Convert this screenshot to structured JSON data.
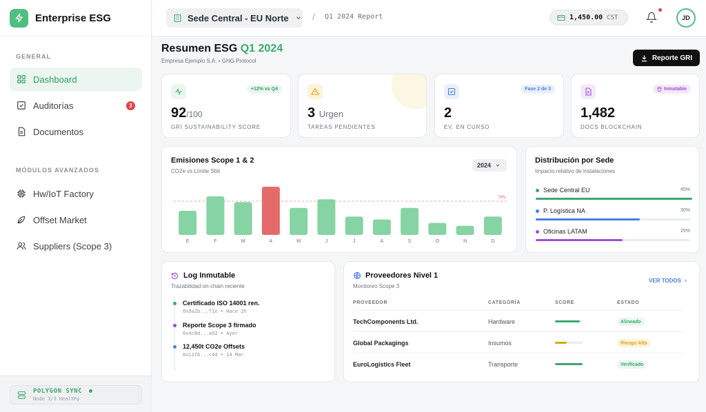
{
  "brand": {
    "name": "Enterprise ESG"
  },
  "sidebar": {
    "section_general": "GENERAL",
    "section_advanced": "MÓDULOS AVANZADOS",
    "items": [
      {
        "label": "Dashboard",
        "icon": "grid-icon"
      },
      {
        "label": "Auditorías",
        "icon": "checkbox-icon",
        "badge": "3"
      },
      {
        "label": "Documentos",
        "icon": "document-icon"
      },
      {
        "label": "Hw/IoT Factory",
        "icon": "chip-icon"
      },
      {
        "label": "Offset Market",
        "icon": "leaf-icon"
      },
      {
        "label": "Suppliers (Scope 3)",
        "icon": "users-icon"
      }
    ],
    "sync": {
      "title": "POLYGON SYNC",
      "subtitle": "Node 3/3 Healthy",
      "color": "#3aa96b"
    }
  },
  "header": {
    "site": "Sede Central - EU Norte",
    "breadcrumb_sep": "/",
    "breadcrumb": "Q1 2024 Report",
    "credits_value": "1,450.00",
    "credits_unit": "CST",
    "avatar": "JD"
  },
  "page": {
    "title": "Resumen ESG",
    "title_accent": "Q1 2024",
    "subtitle": "Empresa Ejemplo S.A. • GHG Protocol",
    "report_button": "Reporte GRI"
  },
  "kpis": [
    {
      "value": "92",
      "suffix": "/100",
      "label": "GRI SUSTAINABILITY SCORE",
      "badge": "+12% vs Q4",
      "color": "#3aa96b"
    },
    {
      "value": "3",
      "suffix": "Urgen",
      "label": "TAREAS PENDIENTES",
      "badge": "",
      "color": "#d9a514"
    },
    {
      "value": "2",
      "suffix": "",
      "label": "EV. EN CURSO",
      "badge": "Fase 2 de 3",
      "color": "#4a7de0"
    },
    {
      "value": "1,482",
      "suffix": "",
      "label": "DOCS BLOCKCHAIN",
      "badge": "Inmutable",
      "color": "#9b4fd6"
    }
  ],
  "emissions": {
    "title": "Emisiones Scope 1 & 2",
    "subtitle": "CO2e vs Límite Sbti",
    "year": "2024",
    "limit_label": "70%"
  },
  "chart_data": {
    "type": "bar",
    "title": "Emisiones Scope 1 & 2",
    "categories": [
      "E",
      "F",
      "M",
      "A",
      "M",
      "J",
      "J",
      "A",
      "S",
      "O",
      "N",
      "D"
    ],
    "values": [
      50,
      80,
      68,
      100,
      56,
      74,
      38,
      32,
      56,
      25,
      19,
      38
    ],
    "limit": 70,
    "ylim": [
      0,
      100
    ],
    "highlight_index": 3,
    "colors": {
      "normal": "#86d4a3",
      "highlight": "#e56b6b",
      "limit": "#f2a5a5"
    },
    "grid": false
  },
  "distribution": {
    "title": "Distribución por Sede",
    "subtitle": "Impacto relativo de instalaciones",
    "items": [
      {
        "label": "Sede Central EU",
        "pct_label": "45%",
        "pct": 45,
        "color": "#3aa96b"
      },
      {
        "label": "P. Logística NA",
        "pct_label": "30%",
        "pct": 30,
        "color": "#4a7de0"
      },
      {
        "label": "Oficinas LATAM",
        "pct_label": "25%",
        "pct": 25,
        "color": "#9b4fd6"
      }
    ]
  },
  "log": {
    "title": "Log Inmutable",
    "subtitle": "Trazabilidad on-chain reciente",
    "items": [
      {
        "title": "Certificado ISO 14001 ren.",
        "meta": "0x9a2b...f1e • Hace 2h",
        "color": "#3aa96b"
      },
      {
        "title": "Reporte Scope 3 firmado",
        "meta": "0x4c8d...a92 • Ayer",
        "color": "#9b4fd6"
      },
      {
        "title": "12,450t CO2e Offsets",
        "meta": "0x11fb...c44 • 14 Mar",
        "color": "#4a7de0"
      }
    ]
  },
  "suppliers": {
    "title": "Proveedores Nivel 1",
    "subtitle": "Monitoreo Scope 3",
    "view_all": "VER TODOS",
    "columns": [
      "PROVEEDOR",
      "CATEGORÍA",
      "SCORE",
      "ESTADO"
    ],
    "rows": [
      {
        "name": "TechComponents Ltd.",
        "category": "Hardware",
        "score": 0.9,
        "status": "Alineado",
        "color": "#3aa96b"
      },
      {
        "name": "Global Packagings",
        "category": "Insumos",
        "score": 0.42,
        "status": "Riesgo Alto",
        "color": "#d9a514"
      },
      {
        "name": "EuroLogistics Fleet",
        "category": "Transporte",
        "score": 1.0,
        "status": "Verificado",
        "color": "#3aa96b"
      }
    ]
  }
}
